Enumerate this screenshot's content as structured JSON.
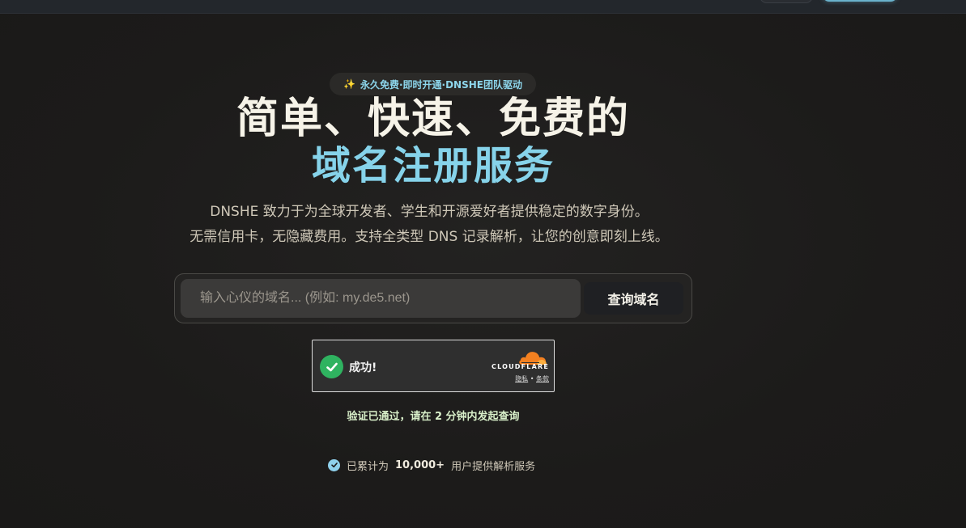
{
  "badge": {
    "icon": "sparkle-icon",
    "text": "永久免费·即时开通·DNSHE团队驱动"
  },
  "hero": {
    "title_line1": "简单、快速、免费的",
    "title_line2": "域名注册服务",
    "desc_line1": "DNSHE 致力于为全球开发者、学生和开源爱好者提供稳定的数字身份。",
    "desc_line2": "无需信用卡，无隐藏费用。支持全类型 DNS 记录解析，让您的创意即刻上线。"
  },
  "search": {
    "placeholder": "输入心仪的域名... (例如: my.de5.net)",
    "value": "",
    "button_label": "查询域名"
  },
  "captcha": {
    "status": "成功!",
    "brand": "CLOUDFLARE",
    "privacy_link": "隐私",
    "separator": "•",
    "terms_link": "条款"
  },
  "verify_message": "验证已通过，请在 2 分钟内发起查询",
  "stats": {
    "prefix": "已累计为",
    "count": "10,000+",
    "suffix": "用户提供解析服务"
  },
  "colors": {
    "accent": "#86d3ea",
    "success": "#2fb360",
    "cloudflare_orange": "#f38020",
    "background": "#1c1b1a"
  }
}
